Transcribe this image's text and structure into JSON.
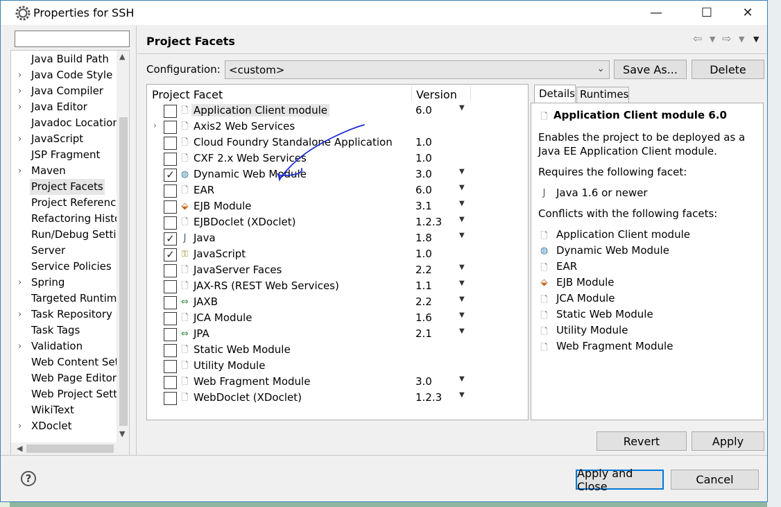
{
  "window": {
    "title": "Properties for SSH",
    "minimize": "—",
    "maximize": "☐",
    "close": "✕"
  },
  "nav": {
    "filter_value": "",
    "items": [
      {
        "label": "Java Build Path",
        "expandable": false
      },
      {
        "label": "Java Code Style",
        "expandable": true
      },
      {
        "label": "Java Compiler",
        "expandable": true
      },
      {
        "label": "Java Editor",
        "expandable": true
      },
      {
        "label": "Javadoc Location",
        "expandable": false
      },
      {
        "label": "JavaScript",
        "expandable": true
      },
      {
        "label": "JSP Fragment",
        "expandable": false
      },
      {
        "label": "Maven",
        "expandable": true
      },
      {
        "label": "Project Facets",
        "expandable": false,
        "selected": true
      },
      {
        "label": "Project References",
        "expandable": false
      },
      {
        "label": "Refactoring History",
        "expandable": false
      },
      {
        "label": "Run/Debug Settings",
        "expandable": false
      },
      {
        "label": "Server",
        "expandable": false
      },
      {
        "label": "Service Policies",
        "expandable": false
      },
      {
        "label": "Spring",
        "expandable": true
      },
      {
        "label": "Targeted Runtimes",
        "expandable": false
      },
      {
        "label": "Task Repository",
        "expandable": true
      },
      {
        "label": "Task Tags",
        "expandable": false
      },
      {
        "label": "Validation",
        "expandable": true
      },
      {
        "label": "Web Content Settings",
        "expandable": false
      },
      {
        "label": "Web Page Editor",
        "expandable": false
      },
      {
        "label": "Web Project Settings",
        "expandable": false
      },
      {
        "label": "WikiText",
        "expandable": false
      },
      {
        "label": "XDoclet",
        "expandable": true
      }
    ]
  },
  "page": {
    "title": "Project Facets",
    "config_label": "Configuration:",
    "config_value": "<custom>",
    "save_as": "Save As...",
    "delete": "Delete"
  },
  "table": {
    "col_facet": "Project Facet",
    "col_version": "Version",
    "rows": [
      {
        "name": "Application Client module",
        "version": "6.0",
        "checked": false,
        "dropdown": true,
        "icon": "page-icon",
        "selected": true
      },
      {
        "name": "Axis2 Web Services",
        "version": "",
        "checked": false,
        "dropdown": false,
        "icon": "page-icon",
        "expandable": true
      },
      {
        "name": "Cloud Foundry Standalone Application",
        "version": "1.0",
        "checked": false,
        "dropdown": false,
        "icon": "page-icon"
      },
      {
        "name": "CXF 2.x Web Services",
        "version": "1.0",
        "checked": false,
        "dropdown": false,
        "icon": "page-icon"
      },
      {
        "name": "Dynamic Web Module",
        "version": "3.0",
        "checked": true,
        "dropdown": true,
        "icon": "globe-icon"
      },
      {
        "name": "EAR",
        "version": "6.0",
        "checked": false,
        "dropdown": true,
        "icon": "page-icon"
      },
      {
        "name": "EJB Module",
        "version": "3.1",
        "checked": false,
        "dropdown": true,
        "icon": "bean-icon"
      },
      {
        "name": "EJBDoclet (XDoclet)",
        "version": "1.2.3",
        "checked": false,
        "dropdown": true,
        "icon": "page-icon"
      },
      {
        "name": "Java",
        "version": "1.8",
        "checked": true,
        "dropdown": true,
        "icon": "java-icon"
      },
      {
        "name": "JavaScript",
        "version": "1.0",
        "checked": true,
        "dropdown": false,
        "icon": "js-icon"
      },
      {
        "name": "JavaServer Faces",
        "version": "2.2",
        "checked": false,
        "dropdown": true,
        "icon": "page-icon"
      },
      {
        "name": "JAX-RS (REST Web Services)",
        "version": "1.1",
        "checked": false,
        "dropdown": true,
        "icon": "page-icon"
      },
      {
        "name": "JAXB",
        "version": "2.2",
        "checked": false,
        "dropdown": true,
        "icon": "arrows-icon"
      },
      {
        "name": "JCA Module",
        "version": "1.6",
        "checked": false,
        "dropdown": true,
        "icon": "page-icon"
      },
      {
        "name": "JPA",
        "version": "2.1",
        "checked": false,
        "dropdown": true,
        "icon": "arrows-icon"
      },
      {
        "name": "Static Web Module",
        "version": "",
        "checked": false,
        "dropdown": false,
        "icon": "page-icon"
      },
      {
        "name": "Utility Module",
        "version": "",
        "checked": false,
        "dropdown": false,
        "icon": "page-icon"
      },
      {
        "name": "Web Fragment Module",
        "version": "3.0",
        "checked": false,
        "dropdown": true,
        "icon": "page-icon"
      },
      {
        "name": "WebDoclet (XDoclet)",
        "version": "1.2.3",
        "checked": false,
        "dropdown": true,
        "icon": "page-icon"
      }
    ]
  },
  "details": {
    "tab_details": "Details",
    "tab_runtimes": "Runtimes",
    "heading": "Application Client module 6.0",
    "desc_line1": "Enables the project to be deployed as a",
    "desc_line2": "Java EE Application Client module.",
    "requires_label": "Requires the following facet:",
    "requires": [
      "Java 1.6 or newer"
    ],
    "conflicts_label": "Conflicts with the following facets:",
    "conflicts": [
      {
        "label": "Application Client module",
        "icon": "page-icon"
      },
      {
        "label": "Dynamic Web Module",
        "icon": "globe-icon"
      },
      {
        "label": "EAR",
        "icon": "page-icon"
      },
      {
        "label": "EJB Module",
        "icon": "bean-icon"
      },
      {
        "label": "JCA Module",
        "icon": "page-icon"
      },
      {
        "label": "Static Web Module",
        "icon": "page-icon"
      },
      {
        "label": "Utility Module",
        "icon": "page-icon"
      },
      {
        "label": "Web Fragment Module",
        "icon": "page-icon"
      }
    ]
  },
  "buttons": {
    "revert": "Revert",
    "apply": "Apply",
    "apply_close": "Apply and Close",
    "cancel": "Cancel",
    "help": "?"
  },
  "colors": {
    "accent": "#0078d7",
    "annotation_ink": "#1a2bd6"
  }
}
